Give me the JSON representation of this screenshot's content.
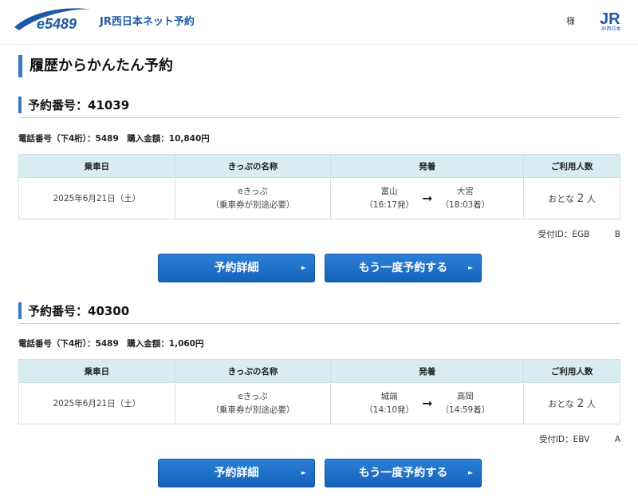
{
  "header": {
    "logo_text": "e5489",
    "brand": "JR西日本ネット予約",
    "honorific": "様",
    "jr_logo": "JR",
    "jr_logo_sub": "JR西日本"
  },
  "page_title": "履歴からかんたん予約",
  "table_headers": [
    "乗車日",
    "きっぷの名称",
    "発着",
    "ご利用人数"
  ],
  "reservations": [
    {
      "heading": "予約番号：41039",
      "info": "電話番号（下4桁）：5489　購入金額：10,840円",
      "date": "2025年6月21日（土）",
      "ticket_name": "eきっぷ",
      "ticket_note": "（乗車券が別途必要）",
      "from": "富山",
      "from_time": "（16:17発）",
      "to": "大宮",
      "to_time": "（18:03着）",
      "people_prefix": "おとな",
      "people_count": "2",
      "people_suffix": "人",
      "receipt": "受付ID：EGB　　　B",
      "detail_button": "予約詳細",
      "rebook_button": "もう一度予約する"
    },
    {
      "heading": "予約番号：40300",
      "info": "電話番号（下4桁）：5489　購入金額：1,060円",
      "date": "2025年6月21日（土）",
      "ticket_name": "eきっぷ",
      "ticket_note": "（乗車券が別途必要）",
      "from": "城端",
      "from_time": "（14:10発）",
      "to": "高岡",
      "to_time": "（14:59着）",
      "people_prefix": "おとな",
      "people_count": "2",
      "people_suffix": "人",
      "receipt": "受付ID：EBV　　　A",
      "detail_button": "予約詳細",
      "rebook_button": "もう一度予約する"
    }
  ],
  "colors": {
    "accent": "#3b78c4",
    "button": "#1a6bc6",
    "table_header": "#d7edf1"
  },
  "icons": {
    "button_arrow": "triangle-right-icon",
    "route_arrow": "arrow-right-icon"
  }
}
